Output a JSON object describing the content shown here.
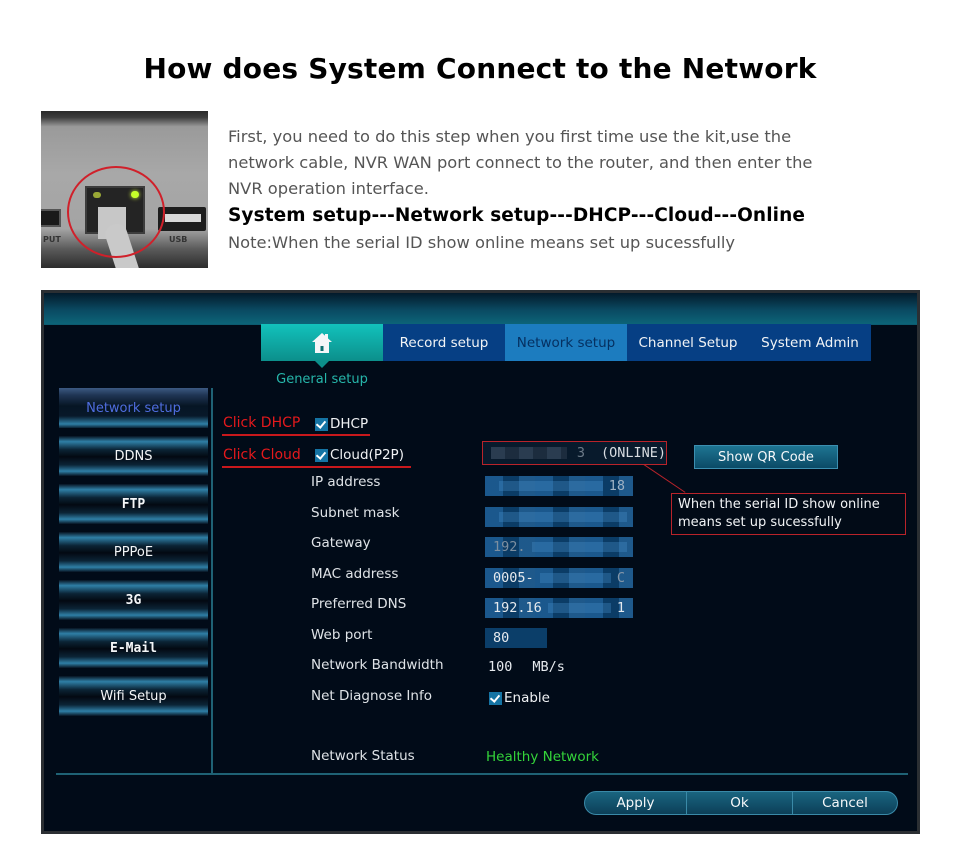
{
  "page": {
    "title": "How does System Connect to the Network"
  },
  "photo": {
    "left_port_label": "PUT",
    "right_port_label": "USB"
  },
  "intro": {
    "paragraph_lines": [
      "First, you need to do this step when you first time use the kit,use the",
      "network cable, NVR WAN port connect to the router, and then enter the",
      "NVR operation interface."
    ],
    "steps": "System setup---Network setup---DHCP---Cloud---Online",
    "note": "Note:When the serial ID show online means set up sucessfully"
  },
  "nvr": {
    "tabs": {
      "home_icon": "home-icon",
      "record": "Record setup",
      "network": "Network setup",
      "channel": "Channel Setup",
      "admin": "System Admin"
    },
    "home_tab_label": "General setup",
    "side_menu": [
      {
        "label": "Network setup",
        "active": true
      },
      {
        "label": "DDNS"
      },
      {
        "label": "FTP"
      },
      {
        "label": "PPPoE"
      },
      {
        "label": "3G"
      },
      {
        "label": "E-Mail"
      },
      {
        "label": "Wifi Setup"
      }
    ],
    "annotations": {
      "click_dhcp": "Click DHCP",
      "click_cloud": "Click Cloud"
    },
    "dhcp": {
      "label": "DHCP",
      "checked": true
    },
    "cloud": {
      "label": "Cloud(P2P)",
      "checked": true
    },
    "serial": {
      "tail": "3",
      "status": "(ONLINE)"
    },
    "show_qr_button": "Show QR Code",
    "callout": "When the serial ID show online means set up sucessfully",
    "fields": {
      "ip_address": {
        "label": "IP address",
        "value_visible": "18"
      },
      "subnet_mask": {
        "label": "Subnet mask",
        "value_visible": ""
      },
      "gateway": {
        "label": "Gateway",
        "value_visible": "192."
      },
      "mac_address": {
        "label": "MAC address",
        "value_visible": "0005-",
        "value_tail": "C"
      },
      "preferred_dns": {
        "label": "Preferred DNS",
        "value_visible": "192.16",
        "value_tail": "1"
      },
      "web_port": {
        "label": "Web port",
        "value": "80"
      },
      "network_bandwidth": {
        "label": "Network Bandwidth",
        "value": "100",
        "unit": "MB/s"
      },
      "net_diagnose": {
        "label": "Net Diagnose Info",
        "option": "Enable",
        "checked": true
      },
      "network_status": {
        "label": "Network Status",
        "value": "Healthy Network"
      }
    },
    "buttons": {
      "apply": "Apply",
      "ok": "Ok",
      "cancel": "Cancel"
    },
    "colors": {
      "accent_teal": "#12c2bc",
      "tab_blue": "#063f84",
      "tab_active": "#1c7cbf",
      "annotation_red": "#e4191c",
      "status_green": "#34d43a"
    }
  }
}
